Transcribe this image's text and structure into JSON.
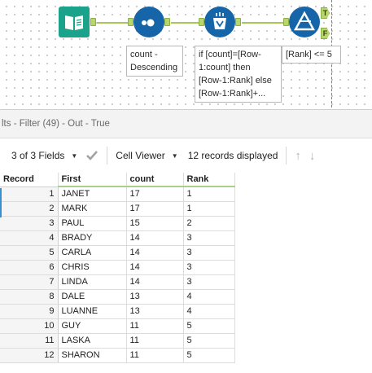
{
  "workflow": {
    "tools": [
      {
        "name": "browse-tool",
        "color": "#1aa38a",
        "icon": "book-icon"
      },
      {
        "name": "sort-tool",
        "color": "#1565a8",
        "icon": "sort-icon"
      },
      {
        "name": "multirow-formula-tool",
        "color": "#1565a8",
        "icon": "multirow-formula-icon"
      },
      {
        "name": "filter-tool",
        "color": "#1565a8",
        "icon": "filter-icon"
      }
    ],
    "annotations": {
      "sort": "count -\nDescending",
      "multirow": "if [count]=[Row-\n1:count] then\n[Row-1:Rank] else\n[Row-1:Rank]+...",
      "filter": "[Rank] <= 5"
    },
    "anchor_true": "T",
    "anchor_false": "F",
    "connector_color": "#a6c85a"
  },
  "results": {
    "header_title": "lts - Filter (49) - Out - True",
    "fields_label": "3 of 3 Fields",
    "viewer_label": "Cell Viewer",
    "records_label": "12 records displayed",
    "columns": [
      "Record",
      "First",
      "count",
      "Rank"
    ],
    "rows": [
      {
        "record": "1",
        "first": "JANET",
        "count": "17",
        "rank": "1"
      },
      {
        "record": "2",
        "first": "MARK",
        "count": "17",
        "rank": "1"
      },
      {
        "record": "3",
        "first": "PAUL",
        "count": "15",
        "rank": "2"
      },
      {
        "record": "4",
        "first": "BRADY",
        "count": "14",
        "rank": "3"
      },
      {
        "record": "5",
        "first": "CARLA",
        "count": "14",
        "rank": "3"
      },
      {
        "record": "6",
        "first": "CHRIS",
        "count": "14",
        "rank": "3"
      },
      {
        "record": "7",
        "first": "LINDA",
        "count": "14",
        "rank": "3"
      },
      {
        "record": "8",
        "first": "DALE",
        "count": "13",
        "rank": "4"
      },
      {
        "record": "9",
        "first": "LUANNE",
        "count": "13",
        "rank": "4"
      },
      {
        "record": "10",
        "first": "GUY",
        "count": "11",
        "rank": "5"
      },
      {
        "record": "11",
        "first": "LASKA",
        "count": "11",
        "rank": "5"
      },
      {
        "record": "12",
        "first": "SHARON",
        "count": "11",
        "rank": "5"
      }
    ]
  }
}
